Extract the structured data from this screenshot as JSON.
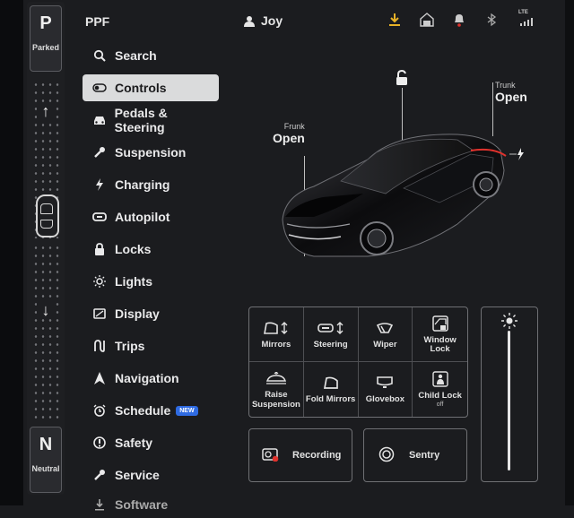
{
  "gear": {
    "park_letter": "P",
    "park_label": "Parked",
    "neutral_letter": "N",
    "neutral_label": "Neutral"
  },
  "header": {
    "app_title": "PPF",
    "user_name": "Joy",
    "icons": [
      "download-icon",
      "garage-icon",
      "notification-bell-icon",
      "bluetooth-icon",
      "lte-signal-icon"
    ],
    "network_label": "LTE",
    "accent": "#e8b227"
  },
  "menu": {
    "items": [
      {
        "label": "Search",
        "icon": "search-icon"
      },
      {
        "label": "Controls",
        "icon": "toggle-icon",
        "active": true
      },
      {
        "label": "Pedals & Steering",
        "icon": "car-icon"
      },
      {
        "label": "Suspension",
        "icon": "wrench-icon"
      },
      {
        "label": "Charging",
        "icon": "bolt-icon"
      },
      {
        "label": "Autopilot",
        "icon": "steering-wheel-icon"
      },
      {
        "label": "Locks",
        "icon": "lock-icon"
      },
      {
        "label": "Lights",
        "icon": "sun-icon"
      },
      {
        "label": "Display",
        "icon": "display-icon"
      },
      {
        "label": "Trips",
        "icon": "trips-icon"
      },
      {
        "label": "Navigation",
        "icon": "navigation-icon"
      },
      {
        "label": "Schedule",
        "icon": "alarm-clock-icon",
        "badge": "NEW"
      },
      {
        "label": "Safety",
        "icon": "safety-icon"
      },
      {
        "label": "Service",
        "icon": "wrench-icon"
      },
      {
        "label": "Software",
        "icon": "download-icon"
      }
    ]
  },
  "vehicle": {
    "frunk_label": "Frunk",
    "frunk_state": "Open",
    "trunk_label": "Trunk",
    "trunk_state": "Open"
  },
  "controls": [
    {
      "label": "Mirrors",
      "icon": "mirror-fold-icon"
    },
    {
      "label": "Steering",
      "icon": "steering-adjust-icon"
    },
    {
      "label": "Wiper",
      "icon": "wiper-icon"
    },
    {
      "label": "Window Lock",
      "icon": "window-lock-icon"
    },
    {
      "label": "Raise Suspension",
      "icon": "raise-suspension-icon"
    },
    {
      "label": "Fold Mirrors",
      "icon": "fold-mirror-icon"
    },
    {
      "label": "Glovebox",
      "icon": "glovebox-icon"
    },
    {
      "label": "Child Lock",
      "sub": "off",
      "icon": "child-lock-icon"
    }
  ],
  "recording": {
    "label": "Recording",
    "icon": "dashcam-icon",
    "dot_color": "#e0322d"
  },
  "sentry": {
    "label": "Sentry",
    "icon": "sentry-icon"
  }
}
